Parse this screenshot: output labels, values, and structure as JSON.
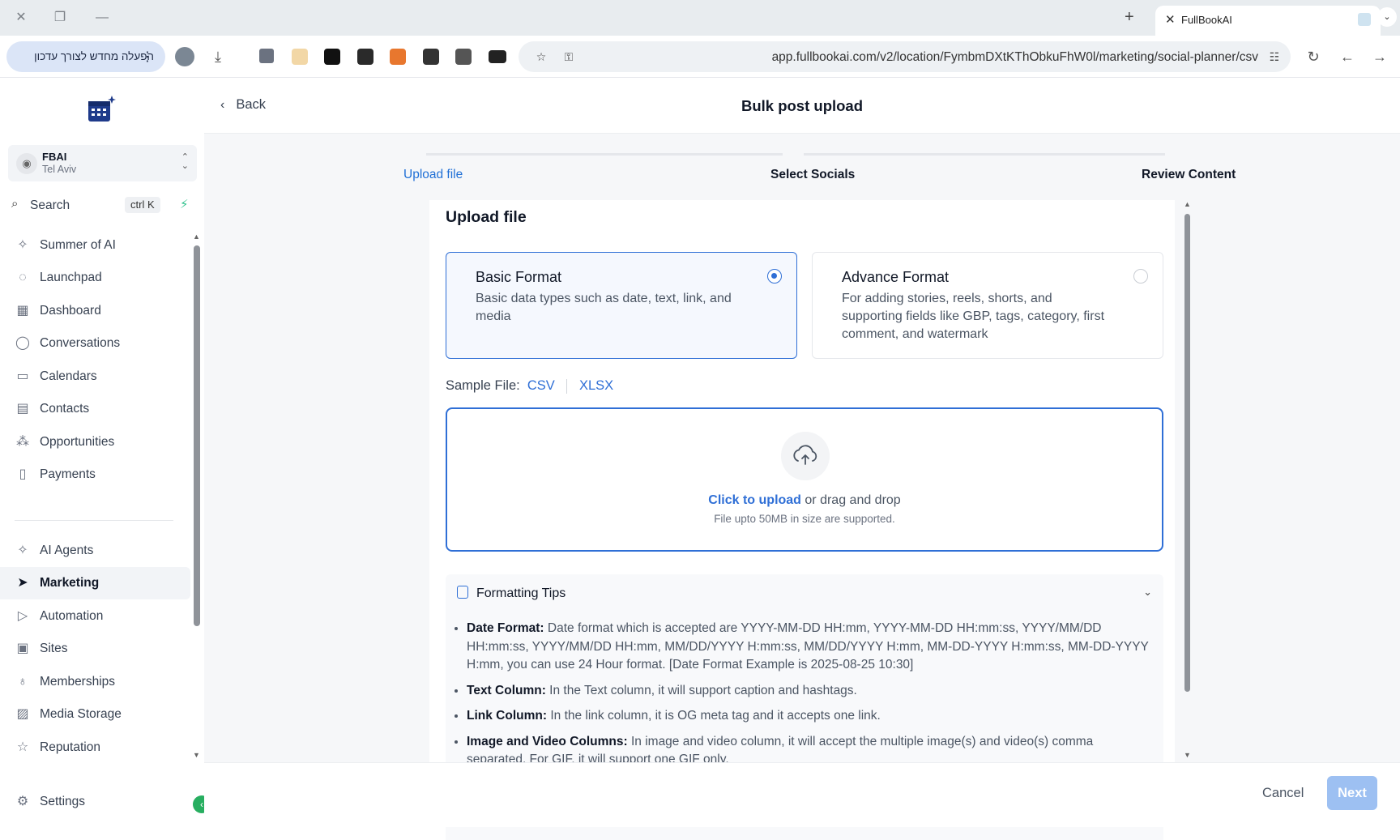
{
  "browser": {
    "tab_title": "FullBookAI",
    "url": "app.fullbookai.com/v2/location/FymbmDXtKThObkuFhW0l/marketing/social-planner/csv",
    "reload_prompt": "הפעלה מחדש לצורך עדכון"
  },
  "location": {
    "name": "FBAI",
    "city": "Tel Aviv"
  },
  "search": {
    "label": "Search",
    "shortcut": "ctrl K"
  },
  "sidebar": {
    "items": [
      {
        "label": "Summer of AI",
        "icon": "sparkle-icon"
      },
      {
        "label": "Launchpad",
        "icon": "rocket-icon"
      },
      {
        "label": "Dashboard",
        "icon": "grid-icon"
      },
      {
        "label": "Conversations",
        "icon": "chat-icon"
      },
      {
        "label": "Calendars",
        "icon": "calendar-icon"
      },
      {
        "label": "Contacts",
        "icon": "contacts-icon"
      },
      {
        "label": "Opportunities",
        "icon": "pipeline-icon"
      },
      {
        "label": "Payments",
        "icon": "payments-icon"
      },
      {
        "label": "AI Agents",
        "icon": "sparkle-icon"
      },
      {
        "label": "Marketing",
        "icon": "send-icon"
      },
      {
        "label": "Automation",
        "icon": "automation-icon"
      },
      {
        "label": "Sites",
        "icon": "globe-icon"
      },
      {
        "label": "Memberships",
        "icon": "badge-icon"
      },
      {
        "label": "Media Storage",
        "icon": "image-icon"
      },
      {
        "label": "Reputation",
        "icon": "star-icon"
      }
    ],
    "settings_label": "Settings",
    "active_item": "Marketing"
  },
  "header": {
    "back_label": "Back",
    "title": "Bulk post upload"
  },
  "steps": [
    {
      "label": "Upload file",
      "state": "active"
    },
    {
      "label": "Select Socials",
      "state": "pending"
    },
    {
      "label": "Review Content",
      "state": "pending"
    }
  ],
  "upload": {
    "title": "Upload file",
    "formats": [
      {
        "title": "Basic Format",
        "description": "Basic data types such as date, text, link, and media",
        "selected": true
      },
      {
        "title": "Advance Format",
        "description": "For adding stories, reels, shorts, and supporting fields like GBP, tags, category, first comment, and watermark",
        "selected": false
      }
    ],
    "sample_label": "Sample File:",
    "sample_csv": "CSV",
    "sample_xlsx": "XLSX",
    "dropzone_link": "Click to upload",
    "dropzone_text": " or drag and drop",
    "dropzone_hint": "File upto 50MB in size are supported."
  },
  "tips": {
    "title": "Formatting Tips",
    "items": [
      {
        "term": "Date Format:",
        "text": " Date format which is accepted are YYYY-MM-DD HH:mm, YYYY-MM-DD HH:mm:ss, YYYY/MM/DD HH:mm:ss, YYYY/MM/DD HH:mm, MM/DD/YYYY H:mm:ss, MM/DD/YYYY H:mm, MM-DD-YYYY H:mm:ss, MM-DD-YYYY H:mm, you can use 24 Hour format. [Date Format Example is 2025-08-25 10:30]"
      },
      {
        "term": "Text Column:",
        "text": " In the Text column, it will support caption and hashtags."
      },
      {
        "term": "Link Column:",
        "text": " In the link column, it is OG meta tag and it accepts one link."
      },
      {
        "term": "Image and Video Columns:",
        "text": " In image and video column, it will accept the multiple image(s) and video(s) comma separated. For GIF, it will support one GIF only."
      }
    ]
  },
  "footer": {
    "cancel_label": "Cancel",
    "next_label": "Next"
  },
  "colors": {
    "accent": "#2f6fd6",
    "next_disabled": "#9dc0f2",
    "collapse": "#27ae60"
  }
}
